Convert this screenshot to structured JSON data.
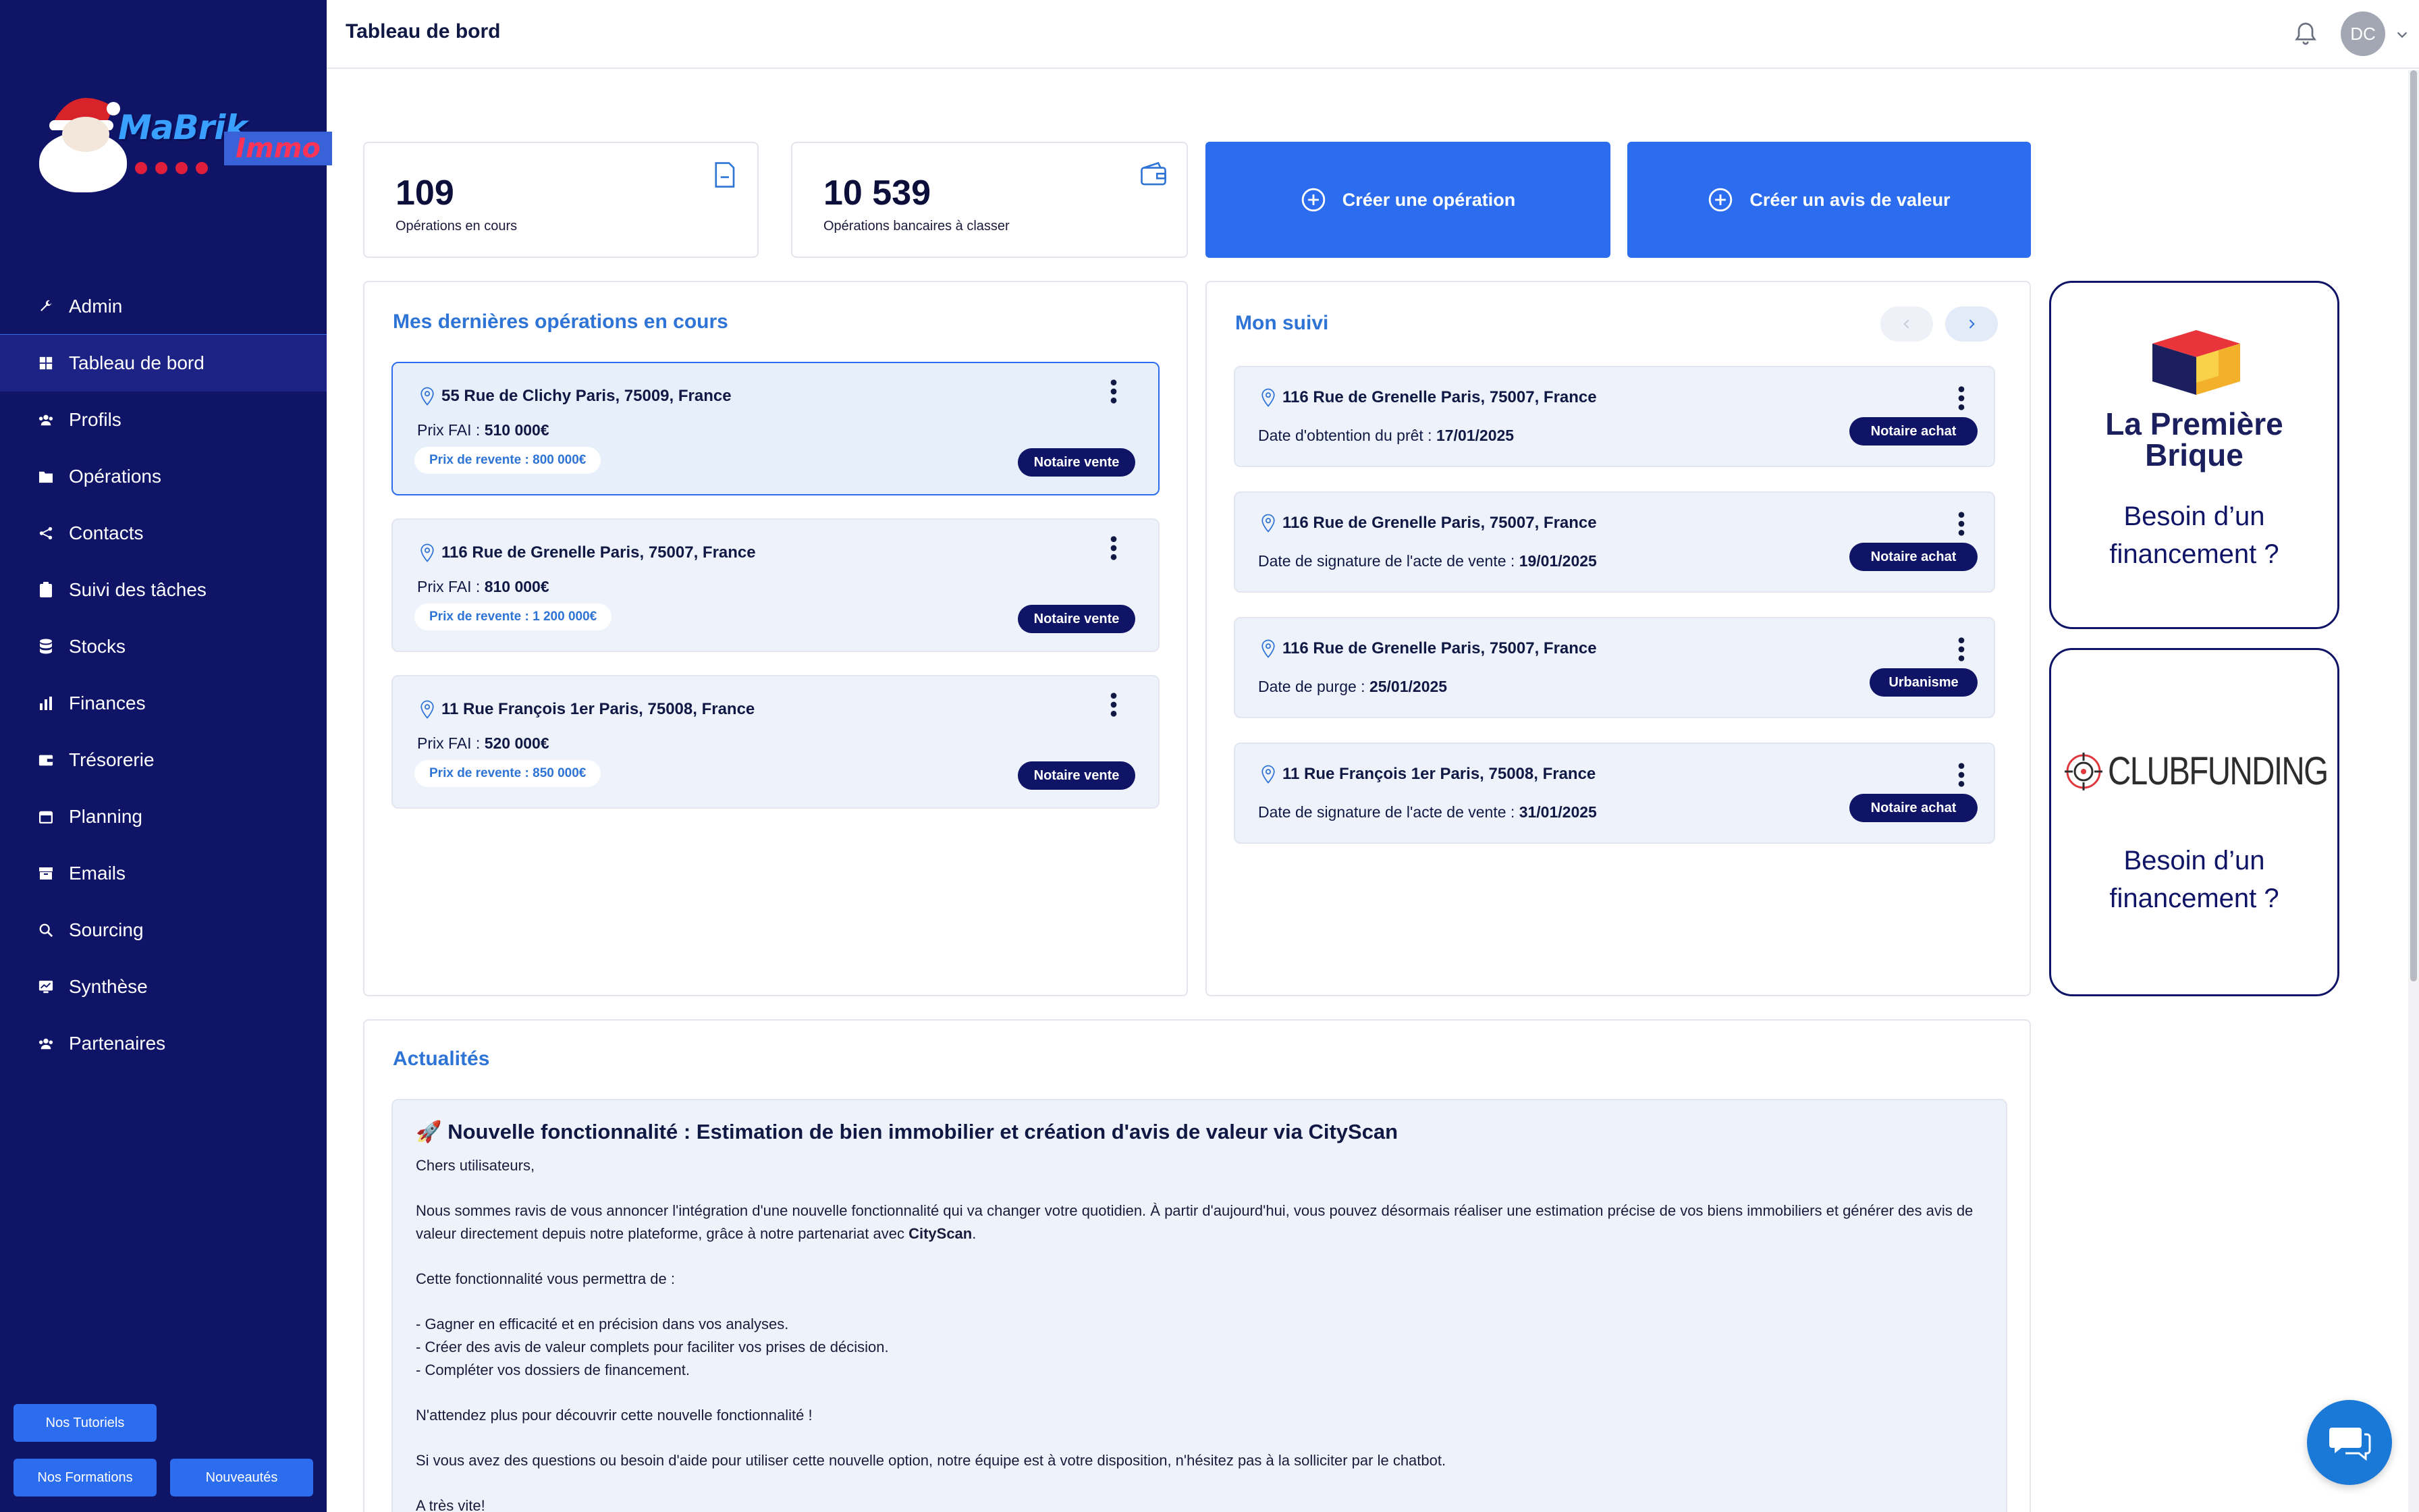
{
  "brand": {
    "logo_text": "MaBrik",
    "logo_tag": "Immo"
  },
  "sidebar": {
    "items": [
      {
        "label": "Admin",
        "icon": "wrench-icon"
      },
      {
        "label": "Tableau de bord",
        "icon": "dashboard-icon"
      },
      {
        "label": "Profils",
        "icon": "users-icon"
      },
      {
        "label": "Opérations",
        "icon": "folder-icon"
      },
      {
        "label": "Contacts",
        "icon": "share-icon"
      },
      {
        "label": "Suivi des tâches",
        "icon": "clipboard-icon"
      },
      {
        "label": "Stocks",
        "icon": "database-icon"
      },
      {
        "label": "Finances",
        "icon": "bar-chart-icon"
      },
      {
        "label": "Trésorerie",
        "icon": "wallet-icon"
      },
      {
        "label": "Planning",
        "icon": "calendar-icon"
      },
      {
        "label": "Emails",
        "icon": "inbox-icon"
      },
      {
        "label": "Sourcing",
        "icon": "search-icon"
      },
      {
        "label": "Synthèse",
        "icon": "report-icon"
      },
      {
        "label": "Partenaires",
        "icon": "users-icon"
      }
    ],
    "buttons": {
      "tutorials": "Nos Tutoriels",
      "trainings": "Nos Formations",
      "news": "Nouveautés"
    }
  },
  "header": {
    "title": "Tableau de bord",
    "avatar_initials": "DC"
  },
  "stats": [
    {
      "value": "109",
      "label": "Opérations en cours"
    },
    {
      "value": "10 539",
      "label": "Opérations bancaires à classer"
    }
  ],
  "actions": {
    "create_operation": "Créer une opération",
    "create_valuation": "Créer un avis de valeur"
  },
  "operations": {
    "title": "Mes dernières opérations en cours",
    "items": [
      {
        "address": "55 Rue de Clichy Paris, 75009, France",
        "price_label": "Prix FAI : ",
        "price": "510 000€",
        "resale": "Prix de revente : 800 000€",
        "badge": "Notaire vente"
      },
      {
        "address": "116 Rue de Grenelle Paris, 75007, France",
        "price_label": "Prix FAI : ",
        "price": "810 000€",
        "resale": "Prix de revente : 1 200 000€",
        "badge": "Notaire vente"
      },
      {
        "address": "11 Rue François 1er Paris, 75008, France",
        "price_label": "Prix FAI : ",
        "price": "520 000€",
        "resale": "Prix de revente : 850 000€",
        "badge": "Notaire vente"
      }
    ]
  },
  "suivi": {
    "title": "Mon suivi",
    "items": [
      {
        "address": "116 Rue de Grenelle Paris, 75007, France",
        "label": "Date d'obtention du prêt : ",
        "date": "17/01/2025",
        "badge": "Notaire achat"
      },
      {
        "address": "116 Rue de Grenelle Paris, 75007, France",
        "label": "Date de signature de l'acte de vente : ",
        "date": "19/01/2025",
        "badge": "Notaire achat"
      },
      {
        "address": "116 Rue de Grenelle Paris, 75007, France",
        "label": "Date de purge : ",
        "date": "25/01/2025",
        "badge": "Urbanisme"
      },
      {
        "address": "11 Rue François 1er Paris, 75008, France",
        "label": "Date de signature de l'acte de vente : ",
        "date": "31/01/2025",
        "badge": "Notaire achat"
      }
    ]
  },
  "partners": [
    {
      "name_line1": "La Première",
      "name_line2": "Brique",
      "need_line1": "Besoin d’un",
      "need_line2": "financement ?"
    },
    {
      "name": "CLUBFUNDING",
      "need_line1": "Besoin d’un",
      "need_line2": "financement ?"
    }
  ],
  "news": {
    "title": "Actualités",
    "headline": "🚀 Nouvelle fonctionnalité : Estimation de bien immobilier et création d'avis de valeur via CityScan",
    "greeting": "Chers utilisateurs,",
    "p1_a": "Nous sommes ravis de vous annoncer l'intégration d'une nouvelle fonctionnalité qui va changer votre quotidien. À partir d'aujourd'hui, vous pouvez désormais réaliser une estimation précise de vos biens immobiliers et générer des avis de valeur directement depuis notre plateforme, grâce à notre partenariat avec ",
    "p1_b": "CityScan",
    "p1_c": ".",
    "p2": "Cette fonctionnalité vous permettra de :",
    "b1": "- Gagner en efficacité et en précision dans vos analyses.",
    "b2": "- Créer des avis de valeur complets pour faciliter vos prises de décision.",
    "b3": "- Compléter vos dossiers de financement.",
    "p3": "N'attendez plus pour découvrir cette nouvelle fonctionnalité !",
    "p4": "Si vous avez des questions ou besoin d'aide pour utiliser cette nouvelle option, notre équipe est à votre disposition, n'hésitez pas à la solliciter par le chatbot.",
    "p5": "A très vite!"
  },
  "colors": {
    "sidebar": "#0f1466",
    "accent": "#2c6df0",
    "section_title": "#2e73d6",
    "badge": "#0f1466"
  }
}
